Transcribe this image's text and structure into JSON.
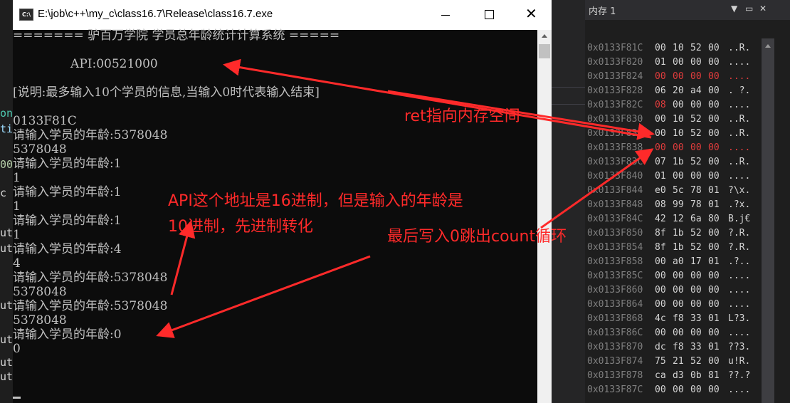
{
  "console": {
    "title": "E:\\job\\c++\\my_c\\class16.7\\Release\\class16.7.exe",
    "app_icon": "C:\\",
    "lines": [
      "======= 驴百万学院 学员总年龄统计计算系统 =====",
      "",
      "               API:00521000",
      "",
      "[说明:最多输入10个学员的信息,当输入0时代表输入结束]",
      "",
      "0133F81C",
      "请输入学员的年龄:5378048",
      "5378048",
      "请输入学员的年龄:1",
      "1",
      "请输入学员的年龄:1",
      "1",
      "请输入学员的年龄:1",
      "1",
      "请输入学员的年龄:4",
      "4",
      "请输入学员的年龄:5378048",
      "5378048",
      "请输入学员的年龄:5378048",
      "5378048",
      "请输入学员的年龄:0",
      "0"
    ]
  },
  "memory": {
    "title": "内存 1",
    "rows": [
      {
        "addr": "0x0133F81C",
        "bytes": [
          "00",
          "10",
          "52",
          "00"
        ],
        "ascii": "..R.",
        "red": false
      },
      {
        "addr": "0x0133F820",
        "bytes": [
          "01",
          "00",
          "00",
          "00"
        ],
        "ascii": "....",
        "red": false
      },
      {
        "addr": "0x0133F824",
        "bytes": [
          "00",
          "00",
          "00",
          "00"
        ],
        "ascii": "....",
        "red": true
      },
      {
        "addr": "0x0133F828",
        "bytes": [
          "06",
          "20",
          "a4",
          "00"
        ],
        "ascii": ". ?.",
        "red": false
      },
      {
        "addr": "0x0133F82C",
        "bytes": [
          "08",
          "00",
          "00",
          "00"
        ],
        "ascii": "....",
        "red": false,
        "red_first": true
      },
      {
        "addr": "0x0133F830",
        "bytes": [
          "00",
          "10",
          "52",
          "00"
        ],
        "ascii": "..R.",
        "red": false
      },
      {
        "addr": "0x0133F834",
        "bytes": [
          "00",
          "10",
          "52",
          "00"
        ],
        "ascii": "..R.",
        "red": false
      },
      {
        "addr": "0x0133F838",
        "bytes": [
          "00",
          "00",
          "00",
          "00"
        ],
        "ascii": "....",
        "red": true
      },
      {
        "addr": "0x0133F83C",
        "bytes": [
          "07",
          "1b",
          "52",
          "00"
        ],
        "ascii": "..R.",
        "red": false
      },
      {
        "addr": "0x0133F840",
        "bytes": [
          "01",
          "00",
          "00",
          "00"
        ],
        "ascii": "....",
        "red": false
      },
      {
        "addr": "0x0133F844",
        "bytes": [
          "e0",
          "5c",
          "78",
          "01"
        ],
        "ascii": "?\\x.",
        "red": false
      },
      {
        "addr": "0x0133F848",
        "bytes": [
          "08",
          "99",
          "78",
          "01"
        ],
        "ascii": ".?x.",
        "red": false
      },
      {
        "addr": "0x0133F84C",
        "bytes": [
          "42",
          "12",
          "6a",
          "80"
        ],
        "ascii": "B.j€",
        "red": false
      },
      {
        "addr": "0x0133F850",
        "bytes": [
          "8f",
          "1b",
          "52",
          "00"
        ],
        "ascii": "?.R.",
        "red": false
      },
      {
        "addr": "0x0133F854",
        "bytes": [
          "8f",
          "1b",
          "52",
          "00"
        ],
        "ascii": "?.R.",
        "red": false
      },
      {
        "addr": "0x0133F858",
        "bytes": [
          "00",
          "a0",
          "17",
          "01"
        ],
        "ascii": ".?..",
        "red": false
      },
      {
        "addr": "0x0133F85C",
        "bytes": [
          "00",
          "00",
          "00",
          "00"
        ],
        "ascii": "....",
        "red": false
      },
      {
        "addr": "0x0133F860",
        "bytes": [
          "00",
          "00",
          "00",
          "00"
        ],
        "ascii": "....",
        "red": false
      },
      {
        "addr": "0x0133F864",
        "bytes": [
          "00",
          "00",
          "00",
          "00"
        ],
        "ascii": "....",
        "red": false
      },
      {
        "addr": "0x0133F868",
        "bytes": [
          "4c",
          "f8",
          "33",
          "01"
        ],
        "ascii": "L?3.",
        "red": false
      },
      {
        "addr": "0x0133F86C",
        "bytes": [
          "00",
          "00",
          "00",
          "00"
        ],
        "ascii": "....",
        "red": false
      },
      {
        "addr": "0x0133F870",
        "bytes": [
          "dc",
          "f8",
          "33",
          "01"
        ],
        "ascii": "??3.",
        "red": false
      },
      {
        "addr": "0x0133F874",
        "bytes": [
          "75",
          "21",
          "52",
          "00"
        ],
        "ascii": "u!R.",
        "red": false
      },
      {
        "addr": "0x0133F878",
        "bytes": [
          "ca",
          "d3",
          "0b",
          "81"
        ],
        "ascii": "??.?",
        "red": false
      },
      {
        "addr": "0x0133F87C",
        "bytes": [
          "00",
          "00",
          "00",
          "00"
        ],
        "ascii": "....",
        "red": false
      }
    ]
  },
  "annotations": {
    "ret_note": "ret指向内存空间",
    "api_note_line1": "API这个地址是16进制，但是输入的年龄是",
    "api_note_line2": "10进制，先进制转化",
    "count_note": "最后写入0跳出count循环",
    "color": "#ff2a2a"
  },
  "ide_fragments": [
    "ong",
    "ti",
    "00",
    "c",
    "ut",
    "ut",
    "ut",
    "ut",
    "ut",
    "ut"
  ]
}
